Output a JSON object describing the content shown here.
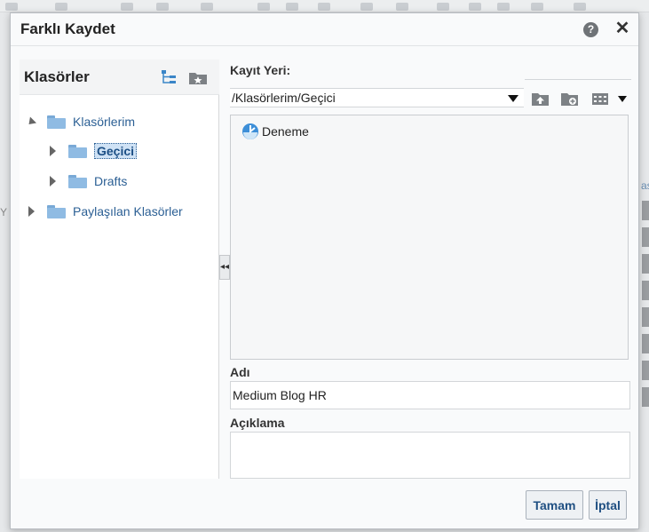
{
  "dialog": {
    "title": "Farklı Kaydet",
    "help_glyph": "?",
    "close_glyph": "✕"
  },
  "folders_pane": {
    "title": "Klasörler",
    "tree": [
      {
        "label": "Klasörlerim",
        "expanded": true,
        "children": [
          {
            "label": "Geçici",
            "selected": true
          },
          {
            "label": "Drafts"
          }
        ]
      },
      {
        "label": "Paylaşılan Klasörler",
        "expanded": false
      }
    ]
  },
  "splitter_glyph": "◂◂",
  "save_location": {
    "label": "Kayıt Yeri:",
    "path": "/Klasörlerim/Geçici",
    "items": [
      {
        "name": "Deneme",
        "icon": "report-icon"
      }
    ]
  },
  "name_field": {
    "label": "Adı",
    "value": "Medium Blog HR"
  },
  "description_field": {
    "label": "Açıklama",
    "value": ""
  },
  "buttons": {
    "ok": "Tamam",
    "cancel": "İptal"
  },
  "background": {
    "left_fragment": "Y",
    "right_fragment": "as"
  },
  "colors": {
    "link": "#2b5f94",
    "folder": "#8fbbe3",
    "selection": "#cfe2f5",
    "button_text": "#1f4f82"
  }
}
